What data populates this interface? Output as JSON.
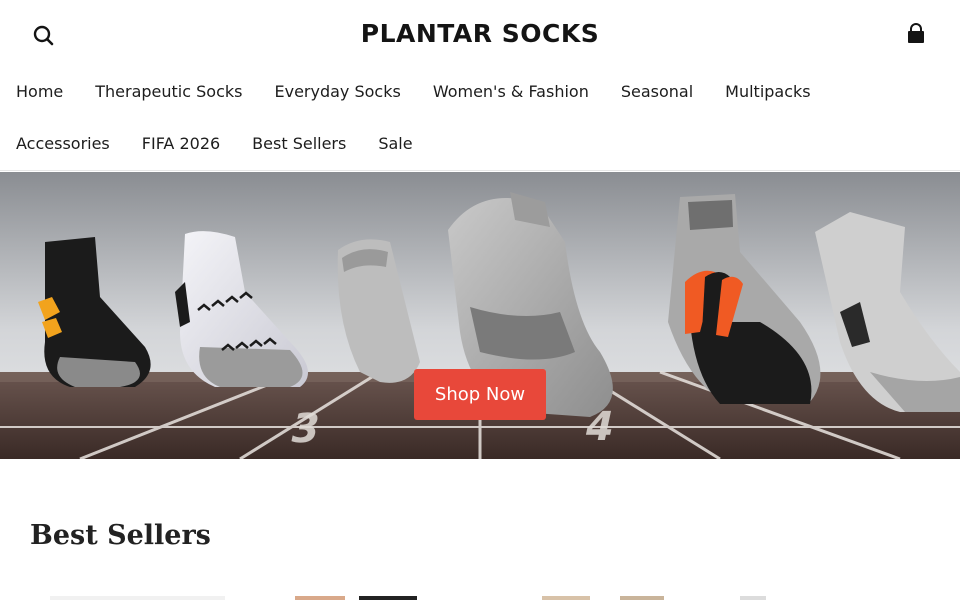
{
  "header": {
    "logo_text": "PLANTAR SOCKS",
    "search_icon": "search-icon",
    "cart_icon": "shopping-bag-icon"
  },
  "nav": {
    "row1": [
      "Home",
      "Therapeutic Socks",
      "Everyday Socks",
      "Women's & Fashion",
      "Seasonal",
      "Multipacks"
    ],
    "row2": [
      "Accessories",
      "FIFA 2026",
      "Best Sellers",
      "Sale"
    ]
  },
  "hero": {
    "cta_label": "Shop Now",
    "cta_color": "#e8483a",
    "track_lane_numbers": [
      "3",
      "4"
    ]
  },
  "best_sellers": {
    "title": "Best Sellers"
  }
}
